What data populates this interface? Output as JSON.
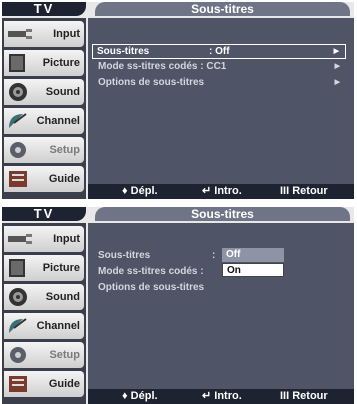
{
  "tv_label": "TV",
  "menu_title": "Sous-titres",
  "sidebar": [
    "Input",
    "Picture",
    "Sound",
    "Channel",
    "Setup",
    "Guide"
  ],
  "panel1": {
    "rows": [
      {
        "label": "Sous-titres",
        "value": ": Off"
      },
      {
        "label": "Mode ss-titres codés : CC1",
        "value": ""
      },
      {
        "label": "Options de sous-titres",
        "value": ""
      }
    ],
    "arrow": "▶"
  },
  "panel2": {
    "rows": [
      {
        "label": "Sous-titres",
        "value": ":"
      },
      {
        "label": "Mode ss-titres codés :",
        "value": ""
      },
      {
        "label": "Options de sous-titres",
        "value": ""
      }
    ],
    "options": [
      "Off",
      "On"
    ],
    "selected": "On"
  },
  "footer": {
    "move": "♦ Dépl.",
    "enter": "↵ Intro.",
    "return": "III Retour"
  },
  "colors": {
    "panel": "#4f5466",
    "bar": "#1e2331",
    "tab": "#6f7487"
  }
}
